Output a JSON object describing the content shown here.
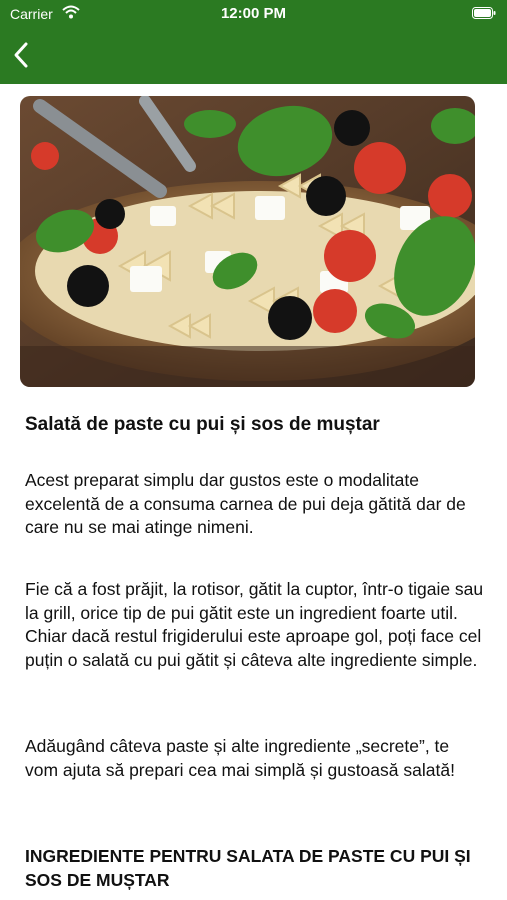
{
  "status_bar": {
    "carrier": "Carrier",
    "time": "12:00 PM"
  },
  "nav": {
    "back_icon": "chevron-left-icon"
  },
  "theme": {
    "brand_green": "#2b7a22"
  },
  "article": {
    "title": "Salată de paste cu pui și sos de muștar",
    "paragraphs": [
      "Acest preparat simplu dar gustos este o modalitate excelentă de a consuma carnea de pui deja gătită dar de care nu se mai atinge nimeni.",
      "Fie că a fost prăjit, la rotisor, gătit la cuptor, într-o tigaie sau la grill, orice tip de pui gătit este un ingredient foarte util. Chiar dacă restul frigiderului este aproape gol, poți face cel puțin o salată cu pui gătit și câteva alte ingrediente simple.",
      "Adăugând câteva paste și alte ingrediente „secrete”, te vom ajuta să prepari cea mai simplă și gustoasă salată!"
    ],
    "section_heading": "INGREDIENTE PENTRU SALATA DE PASTE CU PUI ȘI SOS DE MUȘTAR"
  }
}
